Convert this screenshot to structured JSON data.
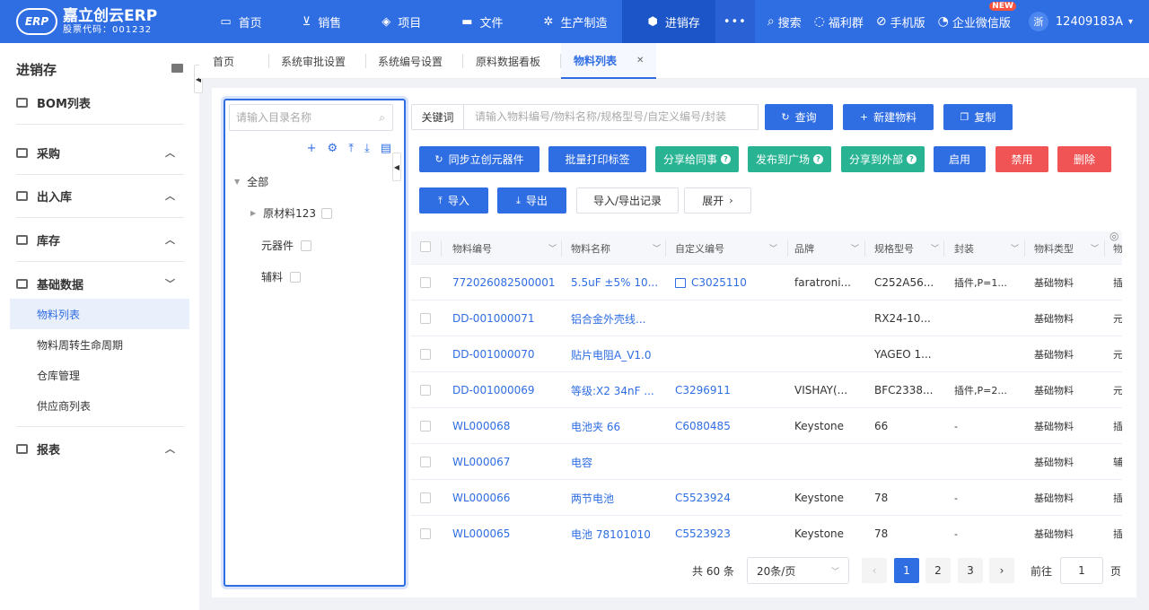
{
  "logo": {
    "mark": "ERP",
    "name": "嘉立创云ERP",
    "stock": "股票代码：001232"
  },
  "nav": [
    {
      "icon": "monitor-icon",
      "glyph": "▭",
      "label": "首页"
    },
    {
      "icon": "cart-icon",
      "glyph": "⊻",
      "label": "销售"
    },
    {
      "icon": "layers-icon",
      "glyph": "◈",
      "label": "项目"
    },
    {
      "icon": "folder-icon",
      "glyph": "▬",
      "label": "文件"
    },
    {
      "icon": "gear-icon",
      "glyph": "✲",
      "label": "生产制造"
    },
    {
      "icon": "box-icon",
      "glyph": "⬢",
      "label": "进销存"
    }
  ],
  "nav_more": "•••",
  "tools": {
    "search": "搜索",
    "welfare": "福利群",
    "mobile": "手机版",
    "wecom": "企业微信版",
    "new_badge": "NEW"
  },
  "user": {
    "avatar": "浙",
    "name": "12409183A",
    "caret": "▾"
  },
  "sidebar": {
    "title": "进销存",
    "groups": {
      "bom": "BOM列表",
      "purchase": "采购",
      "inout": "出入库",
      "stock": "库存",
      "basic": "基础数据",
      "report": "报表"
    },
    "sub": [
      "物料列表",
      "物料周转生命周期",
      "仓库管理",
      "供应商列表"
    ],
    "chev_up": "︿",
    "chev_down": "﹀"
  },
  "tabs": [
    "首页",
    "系统审批设置",
    "系统编号设置",
    "原料数据看板",
    "物料列表"
  ],
  "tab_close": "✕",
  "tree": {
    "placeholder": "请输入目录名称",
    "tools": [
      "+",
      "⚙",
      "⤒",
      "⤓",
      "▤"
    ],
    "root": "全部",
    "children": [
      "原材料123",
      "元器件",
      "辅料"
    ]
  },
  "search": {
    "keyword_label": "关键词",
    "placeholder": "请输入物料编号/物料名称/规格型号/自定义编号/封装"
  },
  "buttons": {
    "query": "查询",
    "new_material": "新建物料",
    "copy": "复制",
    "sync": "同步立创元器件",
    "batch_print": "批量打印标签",
    "share_colleague": "分享给同事",
    "publish_square": "发布到广场",
    "share_external": "分享到外部",
    "enable": "启用",
    "disable": "禁用",
    "delete": "删除",
    "import": "导入",
    "export": "导出",
    "import_export_log": "导入/导出记录",
    "expand": "展开"
  },
  "table": {
    "headers": [
      "物料编号",
      "物料名称",
      "自定义编号",
      "品牌",
      "规格型号",
      "封装",
      "物料类型",
      "物"
    ],
    "rows": [
      [
        "772026082500001",
        "5.5uF ±5% 10...",
        "C3025110",
        "faratroni...",
        "C252A56...",
        "插件,P=1...",
        "基础物料",
        "插"
      ],
      [
        "DD-001000071",
        "铝合金外壳线...",
        "",
        "",
        "RX24-10...",
        "",
        "基础物料",
        "元"
      ],
      [
        "DD-001000070",
        "贴片电阻A_V1.0",
        "",
        "",
        "YAGEO 1...",
        "",
        "基础物料",
        "元"
      ],
      [
        "DD-001000069",
        "等级:X2 34nF ...",
        "C3296911",
        "VISHAY(...",
        "BFC2338...",
        "插件,P=2...",
        "基础物料",
        "元"
      ],
      [
        "WL000068",
        "电池夹 66",
        "C6080485",
        "Keystone",
        "66",
        "-",
        "基础物料",
        "插"
      ],
      [
        "WL000067",
        "电容",
        "",
        "",
        "",
        "",
        "基础物料",
        "辅"
      ],
      [
        "WL000066",
        "两节电池",
        "C5523924",
        "Keystone",
        "78",
        "-",
        "基础物料",
        "插"
      ],
      [
        "WL000065",
        "电池 78101010",
        "C5523923",
        "Keystone",
        "78",
        "-",
        "基础物料",
        "插"
      ]
    ]
  },
  "pager": {
    "total": "共 60 条",
    "size": "20条/页",
    "pages": [
      "1",
      "2",
      "3"
    ],
    "goto": "前往",
    "goto_value": "1",
    "page_unit": "页"
  }
}
